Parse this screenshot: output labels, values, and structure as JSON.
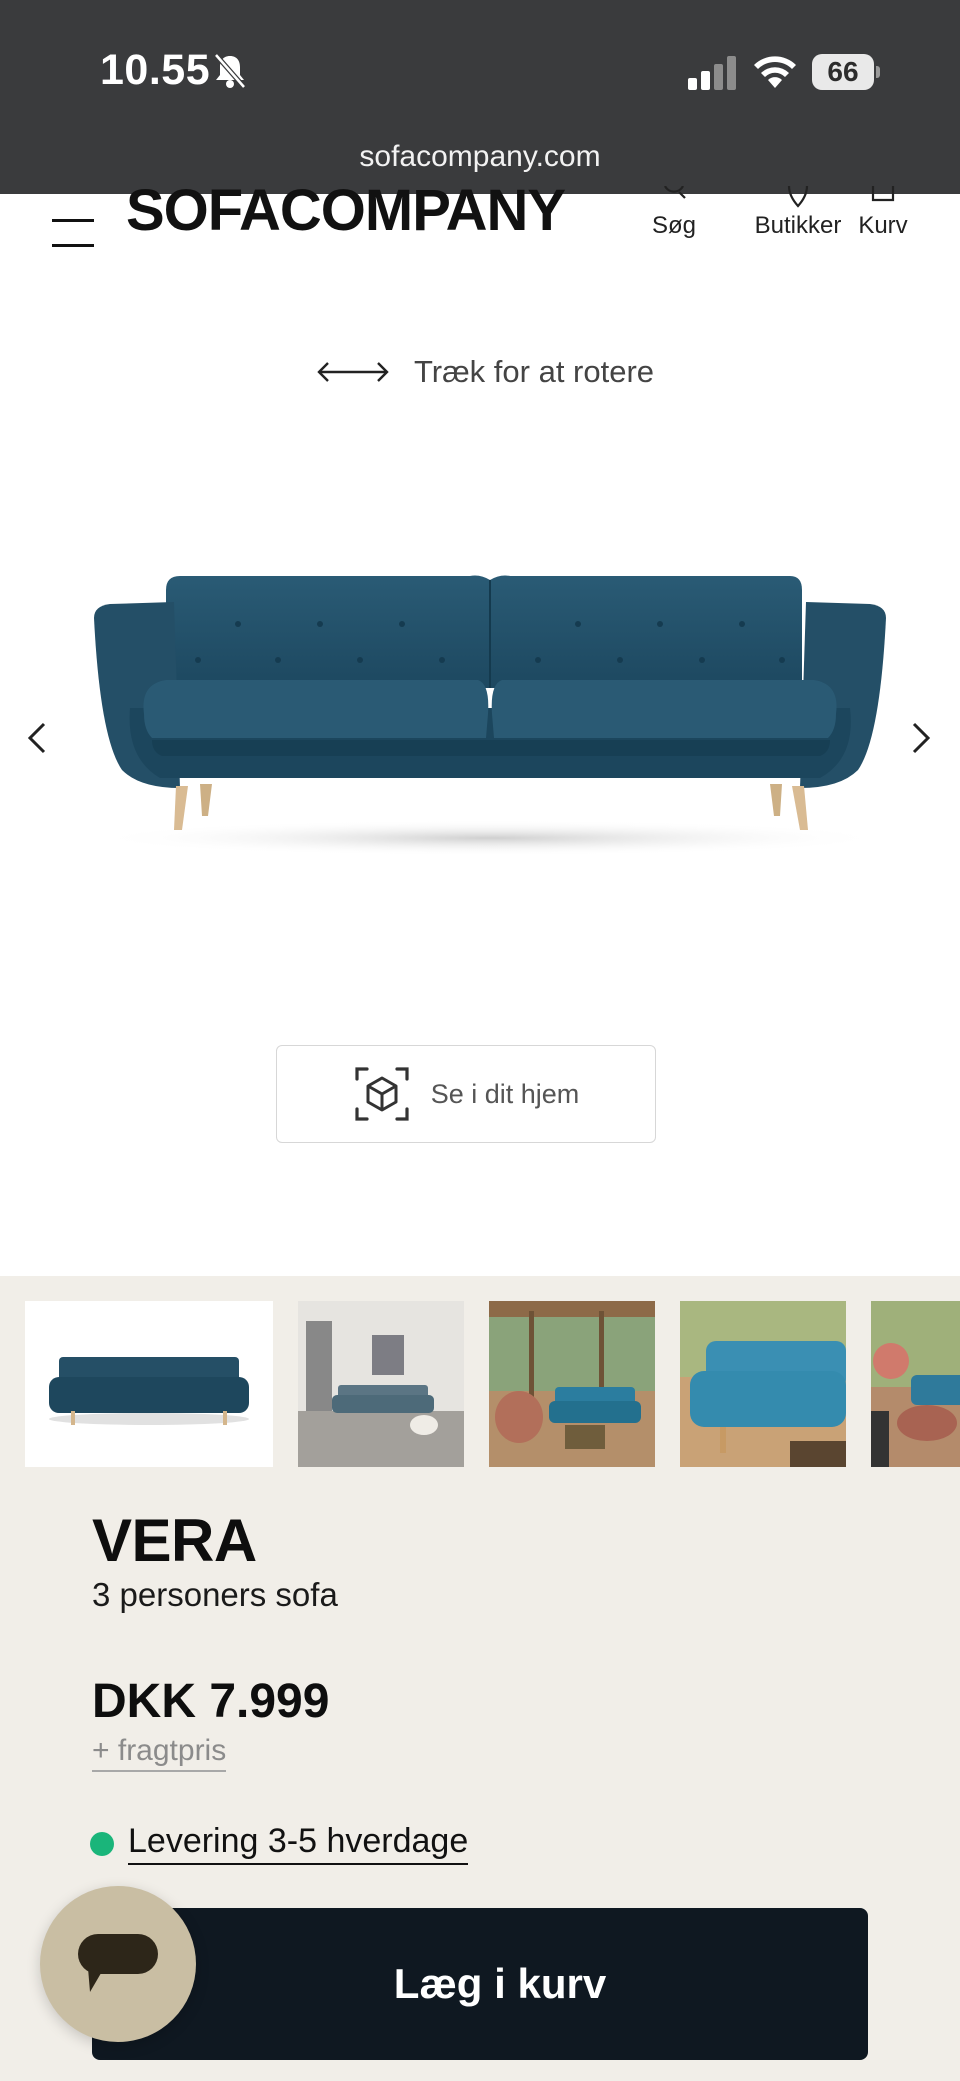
{
  "status_bar": {
    "time": "10.55",
    "battery": "66",
    "url": "sofacompany.com"
  },
  "header": {
    "logo": "SOFACOMPANY",
    "nav": {
      "search": "Søg",
      "stores": "Butikker",
      "cart": "Kurv"
    }
  },
  "viewer": {
    "rotate_hint": "Træk for at rotere",
    "ar_button": "Se i dit hjem"
  },
  "product": {
    "name": "VERA",
    "subtitle": "3 personers sofa",
    "price": "DKK 7.999",
    "freight": "+ fragtpris",
    "delivery": "Levering 3-5 hverdage",
    "add_to_cart": "Læg i kurv"
  },
  "colors": {
    "sofa": "#23526b",
    "cart_button": "#0f1821",
    "delivery_dot": "#1ab57a",
    "chat_bubble": "#c9bea3",
    "page_bg": "#f1eee8"
  },
  "icons": [
    "bell-slash-icon",
    "signal-icon",
    "wifi-icon",
    "battery-icon",
    "hamburger-icon",
    "search-icon",
    "location-pin-icon",
    "bag-icon",
    "rotate-arrows-icon",
    "chevron-left-icon",
    "chevron-right-icon",
    "ar-cube-icon",
    "chat-icon"
  ]
}
